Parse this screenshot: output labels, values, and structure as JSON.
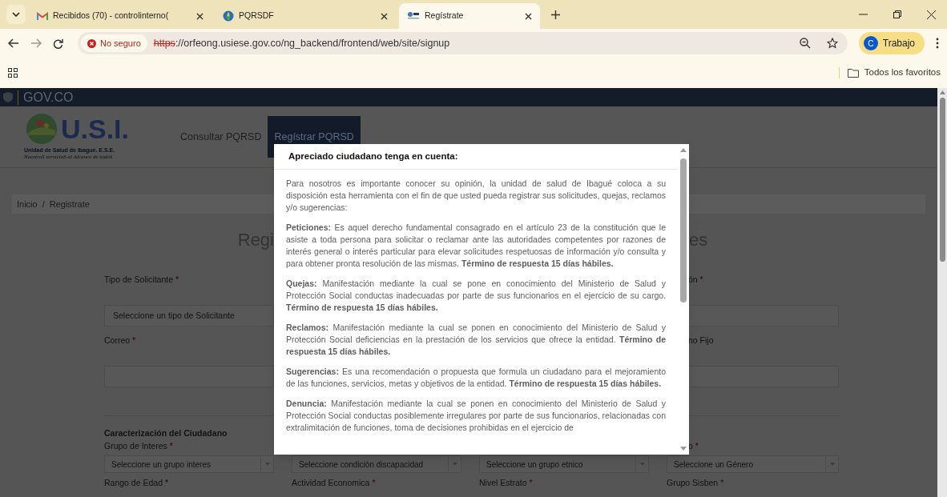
{
  "browser": {
    "tabs": [
      {
        "title": "Recibidos (70) - controlinterno(",
        "selected": false,
        "kind": "mail"
      },
      {
        "title": "PQRSDF",
        "selected": false,
        "kind": "globe"
      },
      {
        "title": "Regístrate",
        "selected": true,
        "kind": "site"
      }
    ],
    "security": "No seguro",
    "url_scheme": "https",
    "url_rest": "://orfeong.usiese.gov.co/ng_backend/frontend/web/site/signup",
    "profile": {
      "initial": "C",
      "name": "Trabajo"
    },
    "bookmarks_folder": "Todos los favoritos"
  },
  "gov_bar": "GOV.CO",
  "header": {
    "brand": "U.S.I.",
    "org": "Unidad de Salud de Ibagué. E.S.E.",
    "slogan": "NuestroS servicioS al Alcance de todoS",
    "nav": [
      {
        "label": "Consultar PQRSD",
        "selected": false
      },
      {
        "label": "Regístrar PQRSD",
        "selected": true
      }
    ]
  },
  "breadcrumb": [
    "Inicio",
    "Registrate"
  ],
  "breadcrumb_separator": "/",
  "heading_parts": [
    "Regi",
    "es"
  ],
  "form_rows": [
    {
      "kind": "labels",
      "cells": [
        {
          "text": "Tipo de Solicitante",
          "mark": "*"
        },
        null,
        null,
        {
          "text": "ón",
          "mark": "*"
        }
      ]
    },
    {
      "kind": "inputs",
      "cells": [
        {
          "placeholder": "Seleccione un tipo de Solicitante"
        },
        null,
        null,
        {}
      ]
    },
    {
      "kind": "labels",
      "cells": [
        {
          "text": "Correo",
          "mark": "*"
        },
        null,
        null,
        {
          "text": "no Fijo"
        }
      ]
    },
    {
      "kind": "inputs",
      "cells": [
        {},
        null,
        null,
        {}
      ]
    },
    {
      "kind": "section",
      "title": "Caracterización del Ciudadano"
    },
    {
      "kind": "labels",
      "cells": [
        {
          "text": "Grupo de Interes",
          "mark": "*"
        },
        null,
        null,
        {
          "text": "o",
          "mark": "*"
        }
      ]
    },
    {
      "kind": "selects",
      "cells": [
        {
          "placeholder": "Seleccione un grupo interes"
        },
        {
          "placeholder": "Seleccione condición discapacidad"
        },
        {
          "placeholder": "Seleccione un grupo etnico"
        },
        {
          "placeholder": "Seleccione un Género"
        }
      ]
    },
    {
      "kind": "labels",
      "cells": [
        {
          "text": "Rango de Edad",
          "mark": "*"
        },
        {
          "text": "Actividad Economica",
          "mark": "*"
        },
        {
          "text": "Nivel Estrato",
          "mark": "*"
        },
        {
          "text": "Grupo Sisben",
          "mark": "*"
        }
      ]
    }
  ],
  "dialog": {
    "title": "Apreciado ciudadano tenga en cuenta:",
    "paragraphs": [
      "Para nosotros es importante conocer su opinión, la unidad de salud de Ibagué coloca a su disposición esta herramienta con el fin de que usted pueda registrar sus solicitudes, quejas, reclamos y/o sugerencias:",
      "**Peticiones:** Es aquel derecho fundamental consagrado en el artículo 23 de la constitución que le asiste a toda persona para solicitar o reclamar ante las autoridades competentes por razones de interés general o interés particular para elevar solicitudes respetuosas de información y/o consulta y para obtener pronta resolución de las mismas. **Término de respuesta 15 días hábiles.**",
      "**Quejas:** Manifestación mediante la cual se pone en conocimiento del Ministerio de Salud y Protección Social conductas inadecuadas por parte de sus funcionarios en el ejercicio de su cargo. **Término de respuesta 15 días hábiles.**",
      "**Reclamos:** Manifestación mediante la cual se ponen en conocimiento del Ministerio de Salud y Protección Social deficiencias en la prestación de los servicios que ofrece la entidad. **Término de respuesta 15 días hábiles.**",
      "**Sugerencias:** Es una recomendación o propuesta que formula un ciudadano para el mejoramiento de las funciones, servicios, metas y objetivos de la entidad. **Término de respuesta 15 días hábiles.**",
      "**Denuncia:** Manifestación mediante la cual se ponen en conocimiento del Ministerio de Salud y Protección Social conductas posiblemente irregulares por parte de sus funcionarios, relacionadas con extralimitación de funciones, toma de decisiones prohibidas en el ejercicio de"
    ]
  }
}
